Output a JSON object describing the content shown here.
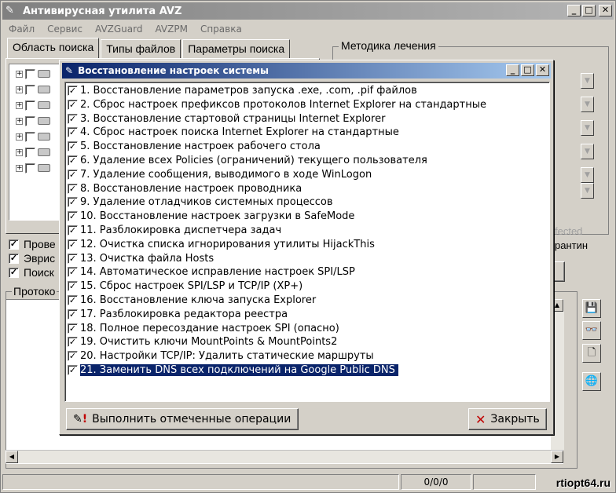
{
  "app": {
    "title": "Антивирусная утилита AVZ",
    "menu": [
      "Файл",
      "Сервис",
      "AVZGuard",
      "AVZPM",
      "Справка"
    ],
    "tabs": [
      "Область поиска",
      "Типы файлов",
      "Параметры поиска"
    ],
    "method_group": "Методика лечения",
    "right_texts": [
      "fected",
      "рантин"
    ],
    "checks": [
      "Прове",
      "Эврис",
      "Поиск"
    ],
    "protocol_label": "Протоко",
    "status_counter": "0/0/0",
    "watermark": "rtiopt64.ru"
  },
  "dialog": {
    "title": "Восстановление настроек системы",
    "items": [
      {
        "label": "1. Восстановление параметров запуска .exe, .com, .pif файлов",
        "checked": true
      },
      {
        "label": "2. Сброс настроек префиксов протоколов Internet Explorer на стандартные",
        "checked": true
      },
      {
        "label": "3. Восстановление стартовой страницы Internet Explorer",
        "checked": true
      },
      {
        "label": "4. Сброс настроек поиска Internet Explorer на стандартные",
        "checked": true
      },
      {
        "label": "5. Восстановление настроек рабочего стола",
        "checked": true
      },
      {
        "label": "6. Удаление всех Policies (ограничений) текущего пользователя",
        "checked": true
      },
      {
        "label": "7. Удаление сообщения, выводимого в ходе WinLogon",
        "checked": true
      },
      {
        "label": "8. Восстановление настроек проводника",
        "checked": true
      },
      {
        "label": "9. Удаление отладчиков системных процессов",
        "checked": true
      },
      {
        "label": "10. Восстановление настроек загрузки в SafeMode",
        "checked": true
      },
      {
        "label": "11. Разблокировка диспетчера задач",
        "checked": true
      },
      {
        "label": "12. Очистка списка игнорирования утилиты HijackThis",
        "checked": true
      },
      {
        "label": "13. Очистка файла Hosts",
        "checked": true
      },
      {
        "label": "14. Автоматическое исправление настроек SPI/LSP",
        "checked": true
      },
      {
        "label": "15. Сброс настроек SPI/LSP и TCP/IP (XP+)",
        "checked": true
      },
      {
        "label": "16. Восстановление ключа запуска Explorer",
        "checked": true
      },
      {
        "label": "17. Разблокировка редактора реестра",
        "checked": true
      },
      {
        "label": "18. Полное пересоздание настроек SPI (опасно)",
        "checked": true
      },
      {
        "label": "19. Очистить ключи MountPoints & MountPoints2",
        "checked": true
      },
      {
        "label": "20. Настройки TCP/IP: Удалить статические маршруты",
        "checked": true
      },
      {
        "label": "21. Заменить DNS всех подключений на Google Public DNS",
        "checked": true,
        "selected": true
      }
    ],
    "run_button": "Выполнить отмеченные операции",
    "close_button": "Закрыть"
  },
  "colors": {
    "title_active": "#0a246a",
    "title_inactive": "#808080",
    "face": "#d4d0c8",
    "selection": "#0a246a"
  }
}
